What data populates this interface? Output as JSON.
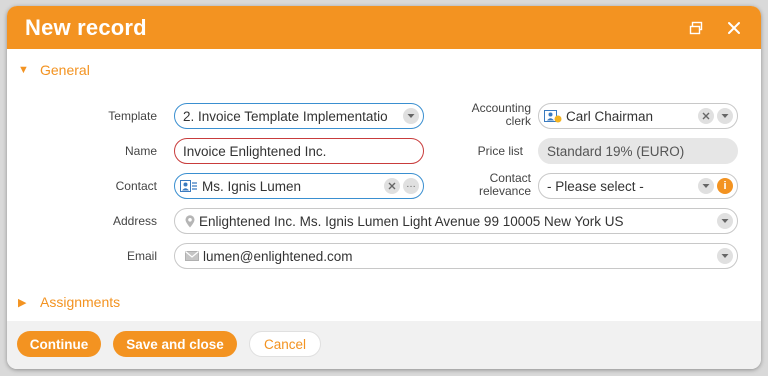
{
  "window": {
    "title": "New record"
  },
  "sections": {
    "general": "General",
    "assignments": "Assignments"
  },
  "form": {
    "template": {
      "label": "Template",
      "value": "2. Invoice Template Implementatio"
    },
    "name": {
      "label": "Name",
      "value": "Invoice Enlightened Inc."
    },
    "contact": {
      "label": "Contact",
      "value": "Ms. Ignis Lumen"
    },
    "address": {
      "label": "Address",
      "value": "Enlightened Inc. Ms. Ignis Lumen Light Avenue 99 10005 New York US"
    },
    "email": {
      "label": "Email",
      "value": "lumen@enlightened.com"
    },
    "accounting_clerk": {
      "label_line1": "Accounting",
      "label_line2": "clerk",
      "value": "Carl Chairman"
    },
    "price_list": {
      "label": "Price list",
      "value": "Standard 19% (EURO)"
    },
    "contact_relevance": {
      "label_line1": "Contact",
      "label_line2": "relevance",
      "value": "- Please select -"
    }
  },
  "footer": {
    "continue": "Continue",
    "save_close": "Save and close",
    "cancel": "Cancel"
  },
  "colors": {
    "accent": "#f39321",
    "focus": "#3a8fd0",
    "error": "#c83c3c"
  },
  "icons": {
    "restore": "window-restore-icon",
    "close": "close-icon",
    "contact_card": "contact-card-icon",
    "clerk": "user-card-icon",
    "location": "location-pin-icon",
    "email": "envelope-icon",
    "clear": "clear-icon",
    "dropdown": "chevron-down-icon",
    "more": "ellipsis-icon",
    "info": "info-icon"
  }
}
